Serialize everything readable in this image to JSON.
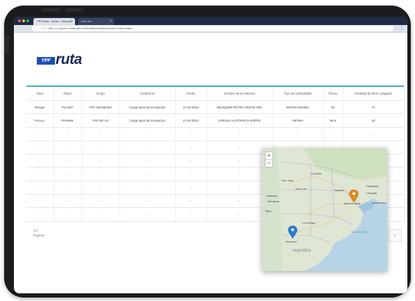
{
  "browser": {
    "tabs": [
      {
        "label": "YPF Ruta · Flotas · Historial"
      },
      {
        "label": "New tab"
      }
    ],
    "tab_close": "×",
    "url": "← → C   ⓘ Sitio no seguro | flotas.ypf.com/ruta/historial/estaciones?vista=mapa",
    "menu": "⋮"
  },
  "logo": {
    "badge": "YPF",
    "word": "ruta"
  },
  "table": {
    "headers": [
      "Alias",
      "Placa",
      "Grupo",
      "Incidencia",
      "Fecha",
      "Nombre de la estación",
      "Tipo de combustible",
      "Precio",
      "Cantidad de litros cargados"
    ],
    "rows": [
      [
        "Ranger",
        "PLG487",
        "YPF NEUQUEN",
        "Carga lejos de la estación",
        "17-03-2021",
        "NEUQUEN PETRO OESTE SRL",
        "INFINIA DIESEL",
        "82",
        "74"
      ],
      [
        "Focus I",
        "FHH066",
        "YPF BS AS",
        "Carga lejos de la estación",
        "17-03-2021",
        "OPESSA AUTOPISTA NORTE",
        "INFINIA",
        "96.6",
        "40"
      ],
      [
        "-",
        "-",
        "-",
        "-",
        "-",
        "-",
        "-",
        "-",
        "-"
      ],
      [
        "-",
        "-",
        "-",
        "-",
        "-",
        "-",
        "-",
        "-",
        "-"
      ],
      [
        "-",
        "-",
        "-",
        "-",
        "-",
        "-",
        "-",
        "-",
        "-"
      ],
      [
        "-",
        "-",
        "-",
        "-",
        "-",
        "-",
        "-",
        "-",
        "-"
      ],
      [
        "-",
        "-",
        "-",
        "-",
        "-",
        "-",
        "-",
        "-",
        "-"
      ],
      [
        "-",
        "-",
        "-",
        "-",
        "-",
        "-",
        "-",
        "-",
        "-"
      ],
      [
        "-",
        "-",
        "-",
        "-",
        "-",
        "-",
        "-",
        "-",
        "-"
      ]
    ]
  },
  "pager": {
    "count": "1/1",
    "label": "Páginas",
    "next": "»"
  },
  "map": {
    "zoom_in": "+",
    "zoom_out": "−",
    "places": [
      {
        "name": "Paraguay"
      },
      {
        "name": "Córdoba"
      },
      {
        "name": "San Juan"
      },
      {
        "name": "San Luis"
      },
      {
        "name": "Santiago"
      },
      {
        "name": "Rosario"
      },
      {
        "name": "Uruguay"
      },
      {
        "name": "Buenos Aires"
      },
      {
        "name": "Montevideo"
      },
      {
        "name": "La Pampa"
      },
      {
        "name": "Talca"
      },
      {
        "name": "Neuquén"
      },
      {
        "name": "Mar del Plata"
      },
      {
        "name": "Argentina"
      },
      {
        "name": "Mendoza"
      }
    ],
    "marker_colors": {
      "orange": "#e08a1e",
      "blue": "#2a7fd4"
    }
  },
  "colors": {
    "accent": "#3fa9c8",
    "brand": "#1b4fb6",
    "frame": "#1c1c1e"
  }
}
